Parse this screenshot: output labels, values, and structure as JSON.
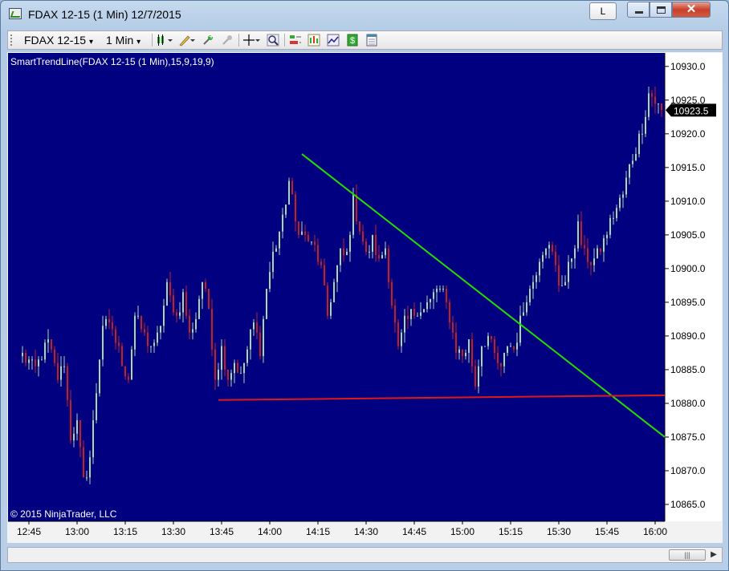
{
  "window": {
    "title": "FDAX 12-15 (1 Min)  12/7/2015",
    "l_button": "L",
    "close_glyph": "✕"
  },
  "toolbar": {
    "instrument": "FDAX 12-15",
    "interval": "1 Min",
    "dropdown_arrow": "▾"
  },
  "chart": {
    "indicator_label": "SmartTrendLine(FDAX 12-15 (1 Min),15,9,19,9)",
    "copyright": "© 2015 NinjaTrader, LLC",
    "current_price": "10923.5",
    "background": "#000080",
    "up_color": "#a8d8a8",
    "down_color": "#c81e1e",
    "trendline_color": "#22dd00",
    "support_color": "#e01818"
  },
  "chart_data": {
    "type": "candlestick",
    "title": "",
    "ylim": [
      10862.5,
      10932.0
    ],
    "y_ticks": [
      "10930.0",
      "10925.0",
      "10920.0",
      "10915.0",
      "10910.0",
      "10905.0",
      "10900.0",
      "10895.0",
      "10890.0",
      "10885.0",
      "10880.0",
      "10875.0",
      "10870.0",
      "10865.0"
    ],
    "x_ticks": [
      "12:45",
      "13:00",
      "13:15",
      "13:30",
      "13:45",
      "14:00",
      "14:15",
      "14:30",
      "14:45",
      "15:00",
      "15:15",
      "15:30",
      "15:45",
      "16:00"
    ],
    "start_time": "12:43",
    "close_path": [
      [
        0,
        10887
      ],
      [
        4,
        10885
      ],
      [
        8,
        10889
      ],
      [
        11,
        10884
      ],
      [
        13,
        10886
      ],
      [
        15,
        10875
      ],
      [
        17,
        10877
      ],
      [
        19,
        10868
      ],
      [
        21,
        10872
      ],
      [
        22,
        10877
      ],
      [
        25,
        10892
      ],
      [
        28,
        10891
      ],
      [
        31,
        10886
      ],
      [
        33,
        10884
      ],
      [
        35,
        10893
      ],
      [
        38,
        10890
      ],
      [
        41,
        10888
      ],
      [
        43,
        10892
      ],
      [
        45,
        10897
      ],
      [
        48,
        10893
      ],
      [
        50,
        10896
      ],
      [
        52,
        10890
      ],
      [
        54,
        10893
      ],
      [
        56,
        10898
      ],
      [
        58,
        10894
      ],
      [
        60,
        10884
      ],
      [
        62,
        10888
      ],
      [
        64,
        10884
      ],
      [
        66,
        10886
      ],
      [
        68,
        10884
      ],
      [
        70,
        10888
      ],
      [
        72,
        10892
      ],
      [
        74,
        10888
      ],
      [
        76,
        10897
      ],
      [
        78,
        10902
      ],
      [
        81,
        10907
      ],
      [
        83,
        10913
      ],
      [
        85,
        10907
      ],
      [
        87,
        10905
      ],
      [
        89,
        10904
      ],
      [
        91,
        10903
      ],
      [
        93,
        10900
      ],
      [
        95,
        10893
      ],
      [
        97,
        10898
      ],
      [
        99,
        10902
      ],
      [
        101,
        10902
      ],
      [
        103,
        10910
      ],
      [
        105,
        10906
      ],
      [
        107,
        10902
      ],
      [
        109,
        10904
      ],
      [
        111,
        10901
      ],
      [
        113,
        10903
      ],
      [
        115,
        10895
      ],
      [
        117,
        10888
      ],
      [
        119,
        10892
      ],
      [
        121,
        10893
      ],
      [
        123,
        10894
      ],
      [
        125,
        10894
      ],
      [
        127,
        10895
      ],
      [
        129,
        10897
      ],
      [
        131,
        10896
      ],
      [
        133,
        10893
      ],
      [
        135,
        10888
      ],
      [
        137,
        10887
      ],
      [
        139,
        10889
      ],
      [
        141,
        10883
      ],
      [
        143,
        10889
      ],
      [
        145,
        10890
      ],
      [
        147,
        10887
      ],
      [
        149,
        10885
      ],
      [
        151,
        10889
      ],
      [
        153,
        10888
      ],
      [
        155,
        10892
      ],
      [
        157,
        10896
      ],
      [
        159,
        10898
      ],
      [
        161,
        10902
      ],
      [
        163,
        10904
      ],
      [
        165,
        10902
      ],
      [
        167,
        10898
      ],
      [
        169,
        10898
      ],
      [
        171,
        10902
      ],
      [
        173,
        10906
      ],
      [
        175,
        10902
      ],
      [
        177,
        10901
      ],
      [
        179,
        10902
      ],
      [
        181,
        10904
      ],
      [
        183,
        10907
      ],
      [
        185,
        10909
      ],
      [
        187,
        10911
      ],
      [
        189,
        10915
      ],
      [
        191,
        10918
      ],
      [
        193,
        10921
      ],
      [
        195,
        10926
      ],
      [
        197,
        10925
      ],
      [
        199,
        10923.5
      ]
    ],
    "trendline": {
      "x": [
        "14:10",
        "16:03"
      ],
      "y": [
        10917.0,
        10875.0
      ]
    },
    "support_line": {
      "x": [
        "13:44",
        "16:03"
      ],
      "y": [
        10880.5,
        10881.2
      ]
    }
  }
}
